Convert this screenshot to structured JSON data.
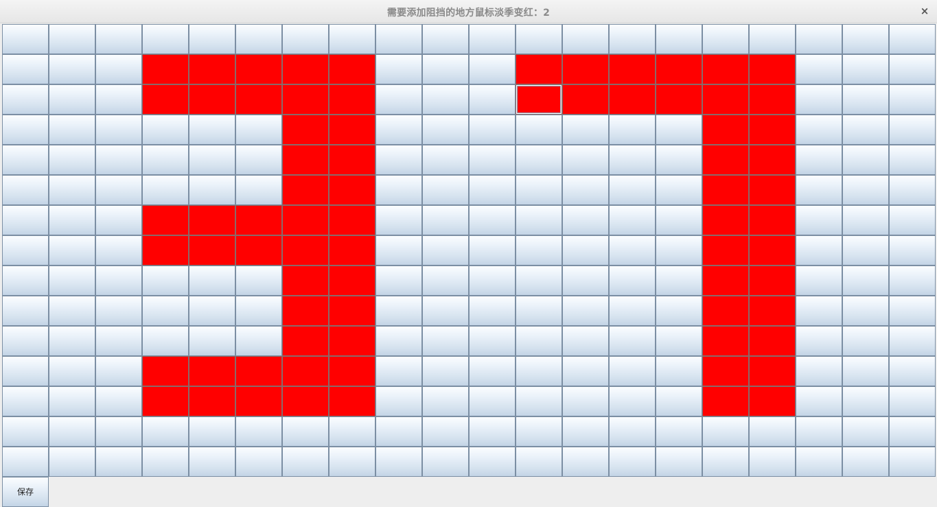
{
  "window": {
    "title": "需要添加阻挡的地方鼠标淡季变红：2",
    "close_icon": "close-icon"
  },
  "grid": {
    "rows": 15,
    "cols": 20,
    "focused_cell": [
      2,
      11
    ],
    "colors": {
      "on": "#ff0000",
      "off": "#dfe9f4"
    },
    "cells": [
      "00000000000000000000",
      "00011111000111111000",
      "00011111000111111000",
      "00000011000000011000",
      "00000011000000011000",
      "00000011000000011000",
      "00011111000000011000",
      "00011111000000011000",
      "00000011000000011000",
      "00000011000000011000",
      "00000011000000011000",
      "00011111000000011000",
      "00011111000000011000",
      "00000000000000000000",
      "00000000000000000000"
    ]
  },
  "footer": {
    "save_label": "保存"
  }
}
